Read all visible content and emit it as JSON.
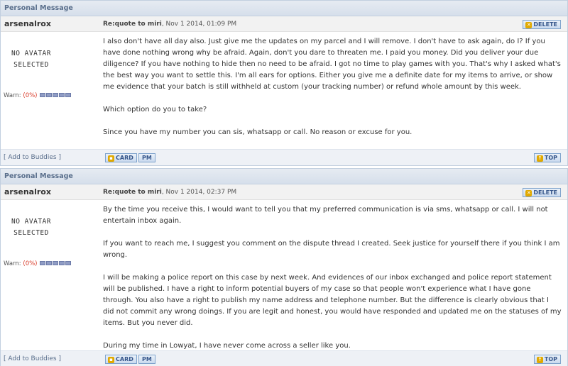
{
  "messages": [
    {
      "header": "Personal Message",
      "author": "arsenalrox",
      "subject": "Re:quote to miri",
      "date": ", Nov 1 2014, 01:09 PM",
      "delete_label": "DELETE",
      "avatar_line1": "NO AVATAR",
      "avatar_line2": "SELECTED",
      "warn_label": "Warn: ",
      "warn_value": "(0%)",
      "paragraphs": [
        "I also don't have all day also. Just give me the updates on my parcel and I will remove. I don't have to ask again, do I? If you have done nothing wrong why be afraid. Again, don't you dare to threaten me. I paid you money. Did you deliver your due diligence? If you have nothing to hide then no need to be afraid. I got no time to play games with you. That's why I asked what's the best way you want to settle this. I'm all ears for options. Either you give me a definite date for my items to arrive, or show me evidence that your batch is still withheld at custom (your tracking number) or refund whole amount by this week.",
        "Which option do you to take?",
        "Since you have my number you can sis, whatsapp or call. No reason or excuse for you."
      ],
      "add_buddies": "[ Add to Buddies ]",
      "card_label": "CARD",
      "pm_label": "PM",
      "top_label": "TOP"
    },
    {
      "header": "Personal Message",
      "author": "arsenalrox",
      "subject": "Re:quote to miri",
      "date": ", Nov 1 2014, 02:37 PM",
      "delete_label": "DELETE",
      "avatar_line1": "NO AVATAR",
      "avatar_line2": "SELECTED",
      "warn_label": "Warn: ",
      "warn_value": "(0%)",
      "paragraphs": [
        "By the time you receive this, I would want to tell you that my preferred communication is via sms, whatsapp or call. I will not entertain inbox again.",
        "If you want to reach me, I suggest you comment on the dispute thread I created. Seek justice for yourself there if you think I am wrong.",
        "I will be making a police report on this case by next week. And evidences of our inbox exchanged and police report statement will be published. I have a right to inform potential buyers of my case so that people won't experience what I have gone through. You also have a right to publish my name address and telephone number. But the difference is clearly obvious that I did not commit any wrong doings. If you are legit and honest, you would have responded and updated me on the statuses of my items. But you never did.",
        "During my time in Lowyat, I have never come across a seller like you."
      ],
      "add_buddies": "[ Add to Buddies ]",
      "card_label": "CARD",
      "pm_label": "PM",
      "top_label": "TOP"
    }
  ]
}
